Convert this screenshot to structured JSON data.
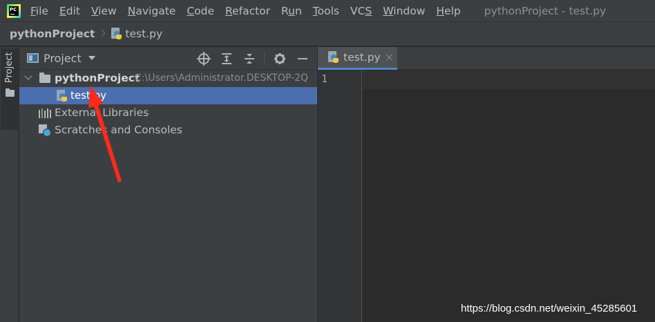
{
  "colors": {
    "accent": "#4b6eaf",
    "arrow": "#ff2a1a",
    "python_blue": "#3b88c3",
    "python_yellow": "#f0c93d"
  },
  "menubar": {
    "logo_text": "PC",
    "items": [
      {
        "pre": "",
        "ul": "F",
        "post": "ile"
      },
      {
        "pre": "",
        "ul": "E",
        "post": "dit"
      },
      {
        "pre": "",
        "ul": "V",
        "post": "iew"
      },
      {
        "pre": "",
        "ul": "N",
        "post": "avigate"
      },
      {
        "pre": "",
        "ul": "C",
        "post": "ode"
      },
      {
        "pre": "",
        "ul": "R",
        "post": "efactor"
      },
      {
        "pre": "R",
        "ul": "u",
        "post": "n"
      },
      {
        "pre": "",
        "ul": "T",
        "post": "ools"
      },
      {
        "pre": "VC",
        "ul": "S",
        "post": ""
      },
      {
        "pre": "",
        "ul": "W",
        "post": "indow"
      },
      {
        "pre": "",
        "ul": "H",
        "post": "elp"
      }
    ],
    "window_title": "pythonProject - test.py"
  },
  "navbar": {
    "project": "pythonProject",
    "file": "test.py"
  },
  "left_strip": {
    "tab_label": "Project"
  },
  "project_panel": {
    "title": "Project",
    "tools": [
      "locate-icon",
      "expand-all-icon",
      "collapse-all-icon",
      "gear-icon",
      "hide-icon"
    ],
    "tree": {
      "root_name": "pythonProject",
      "root_path": "C:\\Users\\Administrator.DESKTOP-2Q",
      "file_name": "test.py",
      "external_libraries": "External Libraries",
      "scratches": "Scratches and Consoles"
    }
  },
  "editor": {
    "tab_label": "test.py",
    "line_numbers": [
      "1"
    ]
  },
  "watermark": "https://blog.csdn.net/weixin_45285601"
}
